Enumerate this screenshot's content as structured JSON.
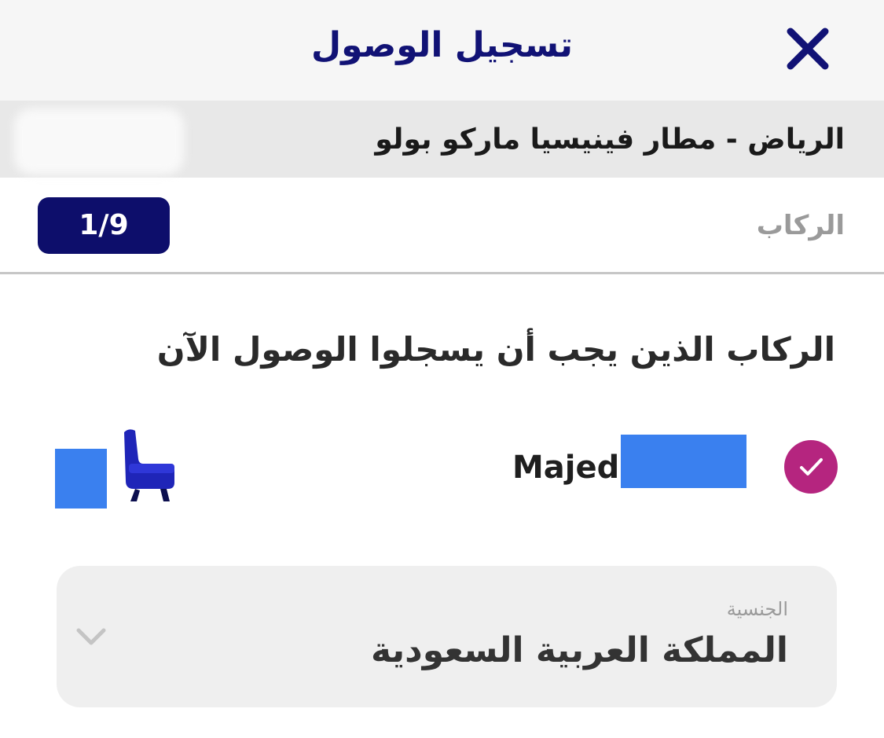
{
  "header": {
    "title": "تسجيل الوصول",
    "close_icon": "close-x-icon"
  },
  "route": {
    "label": "الرياض - مطار فينيسيا ماركو بولو"
  },
  "passengers": {
    "label": "الركاب",
    "count_badge": "1/9"
  },
  "section": {
    "title": "الركاب الذين يجب أن يسجلوا الوصول الآن"
  },
  "passenger": {
    "name": "Majed",
    "checked": true,
    "seat_icon": "seat-icon"
  },
  "nationality": {
    "label": "الجنسية",
    "value": "المملكة العربية السعودية",
    "chevron_icon": "chevron-down-icon"
  },
  "colors": {
    "brand": "#111275",
    "badge": "#0d0e6b",
    "check": "#b5257f",
    "redaction": "#3a80ef"
  }
}
